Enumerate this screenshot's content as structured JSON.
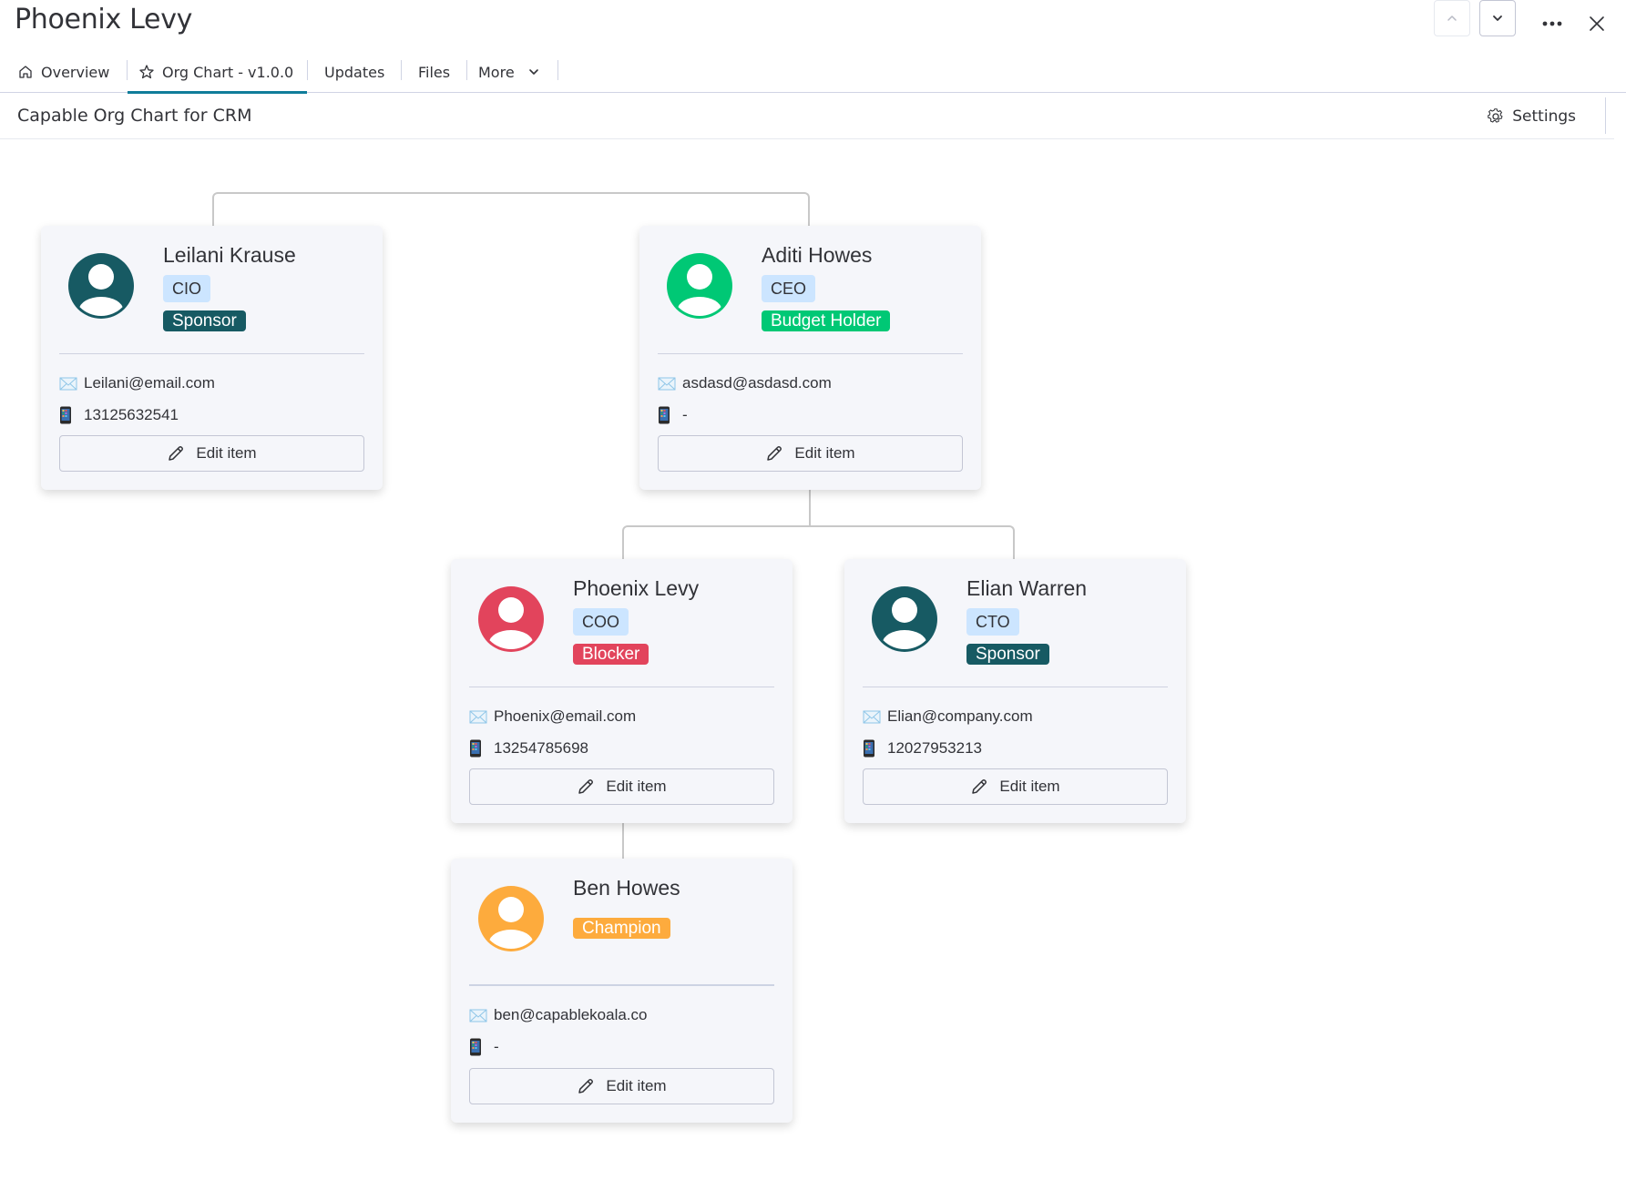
{
  "header": {
    "title": "Phoenix Levy",
    "actions": {
      "prev_icon": "chevron-up-icon",
      "next_icon": "chevron-down-icon",
      "more_icon": "more-horizontal-icon",
      "close_icon": "close-icon"
    }
  },
  "tabs": [
    {
      "label": "Overview",
      "icon": "home-icon",
      "active": false
    },
    {
      "label": "Org Chart - v1.0.0",
      "icon": "star-icon",
      "active": true
    },
    {
      "label": "Updates",
      "active": false
    },
    {
      "label": "Files",
      "active": false
    },
    {
      "label": "More",
      "icon": "chevron-down-icon",
      "active": false
    }
  ],
  "subheader": {
    "board_title": "Capable Org Chart for CRM",
    "settings_label": "Settings",
    "settings_icon": "gear-icon"
  },
  "colors": {
    "accent": "#0f7d9a",
    "role_tag_bg": "#cce5ff",
    "sponsor": "#175a63",
    "budget_holder": "#00c875",
    "blocker": "#e2445c",
    "champion": "#fdab3d",
    "card_bg": "#f5f6fa",
    "connector": "#c8c8c8"
  },
  "org_chart": {
    "nodes": [
      {
        "id": "leilani",
        "name": "Leilani Krause",
        "role": "CIO",
        "status": "Sponsor",
        "status_color": "#175a63",
        "avatar_color": "#175a63",
        "email": "Leilani@email.com",
        "phone": "13125632541",
        "edit_label": "Edit item",
        "parent": null
      },
      {
        "id": "aditi",
        "name": "Aditi Howes",
        "role": "CEO",
        "status": "Budget Holder",
        "status_color": "#00c875",
        "avatar_color": "#00c875",
        "email": "asdasd@asdasd.com",
        "phone": "-",
        "edit_label": "Edit item",
        "parent": null
      },
      {
        "id": "phoenix",
        "name": "Phoenix Levy",
        "role": "COO",
        "status": "Blocker",
        "status_color": "#e2445c",
        "avatar_color": "#e2445c",
        "email": "Phoenix@email.com",
        "phone": "13254785698",
        "edit_label": "Edit item",
        "parent": "aditi"
      },
      {
        "id": "elian",
        "name": "Elian Warren",
        "role": "CTO",
        "status": "Sponsor",
        "status_color": "#175a63",
        "avatar_color": "#175a63",
        "email": "Elian@company.com",
        "phone": "12027953213",
        "edit_label": "Edit item",
        "parent": "aditi"
      },
      {
        "id": "ben",
        "name": "Ben Howes",
        "role": "",
        "status": "Champion",
        "status_color": "#fdab3d",
        "avatar_color": "#fdab3d",
        "email": "ben@capablekoala.co",
        "phone": "-",
        "edit_label": "Edit item",
        "parent": "phoenix"
      }
    ]
  }
}
